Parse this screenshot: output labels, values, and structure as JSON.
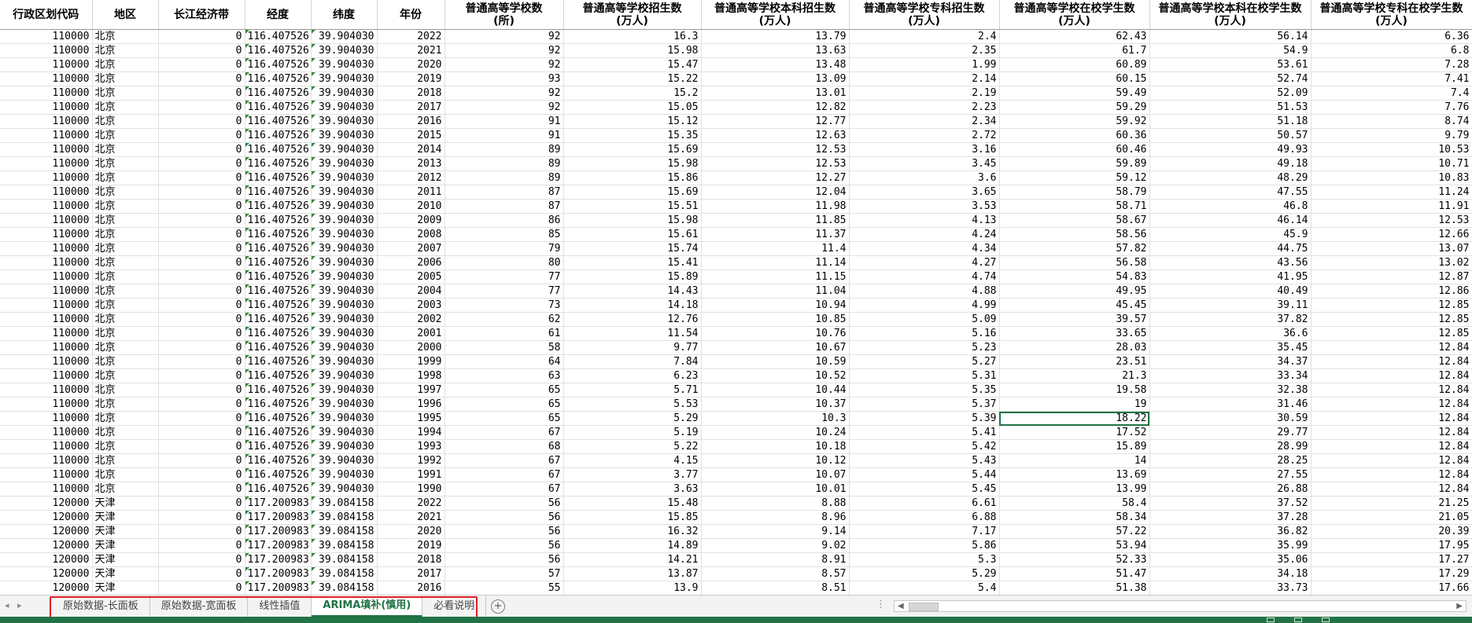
{
  "columns": [
    "行政区划代码",
    "地区",
    "长江经济带",
    "经度",
    "纬度",
    "年份",
    "普通高等学校数\n(所)",
    "普通高等学校招生数\n(万人)",
    "普通高等学校本科招生数\n(万人)",
    "普通高等学校专科招生数\n(万人)",
    "普通高等学校在校学生数\n(万人)",
    "普通高等学校本科在校学生数(万人)",
    "普通高等学校专科在校学生数(万人)"
  ],
  "rows": [
    [
      "110000",
      "北京",
      "0",
      "116.407526",
      "39.904030",
      "2022",
      "92",
      "16.3",
      "13.79",
      "2.4",
      "62.43",
      "56.14",
      "6.36"
    ],
    [
      "110000",
      "北京",
      "0",
      "116.407526",
      "39.904030",
      "2021",
      "92",
      "15.98",
      "13.63",
      "2.35",
      "61.7",
      "54.9",
      "6.8"
    ],
    [
      "110000",
      "北京",
      "0",
      "116.407526",
      "39.904030",
      "2020",
      "92",
      "15.47",
      "13.48",
      "1.99",
      "60.89",
      "53.61",
      "7.28"
    ],
    [
      "110000",
      "北京",
      "0",
      "116.407526",
      "39.904030",
      "2019",
      "93",
      "15.22",
      "13.09",
      "2.14",
      "60.15",
      "52.74",
      "7.41"
    ],
    [
      "110000",
      "北京",
      "0",
      "116.407526",
      "39.904030",
      "2018",
      "92",
      "15.2",
      "13.01",
      "2.19",
      "59.49",
      "52.09",
      "7.4"
    ],
    [
      "110000",
      "北京",
      "0",
      "116.407526",
      "39.904030",
      "2017",
      "92",
      "15.05",
      "12.82",
      "2.23",
      "59.29",
      "51.53",
      "7.76"
    ],
    [
      "110000",
      "北京",
      "0",
      "116.407526",
      "39.904030",
      "2016",
      "91",
      "15.12",
      "12.77",
      "2.34",
      "59.92",
      "51.18",
      "8.74"
    ],
    [
      "110000",
      "北京",
      "0",
      "116.407526",
      "39.904030",
      "2015",
      "91",
      "15.35",
      "12.63",
      "2.72",
      "60.36",
      "50.57",
      "9.79"
    ],
    [
      "110000",
      "北京",
      "0",
      "116.407526",
      "39.904030",
      "2014",
      "89",
      "15.69",
      "12.53",
      "3.16",
      "60.46",
      "49.93",
      "10.53"
    ],
    [
      "110000",
      "北京",
      "0",
      "116.407526",
      "39.904030",
      "2013",
      "89",
      "15.98",
      "12.53",
      "3.45",
      "59.89",
      "49.18",
      "10.71"
    ],
    [
      "110000",
      "北京",
      "0",
      "116.407526",
      "39.904030",
      "2012",
      "89",
      "15.86",
      "12.27",
      "3.6",
      "59.12",
      "48.29",
      "10.83"
    ],
    [
      "110000",
      "北京",
      "0",
      "116.407526",
      "39.904030",
      "2011",
      "87",
      "15.69",
      "12.04",
      "3.65",
      "58.79",
      "47.55",
      "11.24"
    ],
    [
      "110000",
      "北京",
      "0",
      "116.407526",
      "39.904030",
      "2010",
      "87",
      "15.51",
      "11.98",
      "3.53",
      "58.71",
      "46.8",
      "11.91"
    ],
    [
      "110000",
      "北京",
      "0",
      "116.407526",
      "39.904030",
      "2009",
      "86",
      "15.98",
      "11.85",
      "4.13",
      "58.67",
      "46.14",
      "12.53"
    ],
    [
      "110000",
      "北京",
      "0",
      "116.407526",
      "39.904030",
      "2008",
      "85",
      "15.61",
      "11.37",
      "4.24",
      "58.56",
      "45.9",
      "12.66"
    ],
    [
      "110000",
      "北京",
      "0",
      "116.407526",
      "39.904030",
      "2007",
      "79",
      "15.74",
      "11.4",
      "4.34",
      "57.82",
      "44.75",
      "13.07"
    ],
    [
      "110000",
      "北京",
      "0",
      "116.407526",
      "39.904030",
      "2006",
      "80",
      "15.41",
      "11.14",
      "4.27",
      "56.58",
      "43.56",
      "13.02"
    ],
    [
      "110000",
      "北京",
      "0",
      "116.407526",
      "39.904030",
      "2005",
      "77",
      "15.89",
      "11.15",
      "4.74",
      "54.83",
      "41.95",
      "12.87"
    ],
    [
      "110000",
      "北京",
      "0",
      "116.407526",
      "39.904030",
      "2004",
      "77",
      "14.43",
      "11.04",
      "4.88",
      "49.95",
      "40.49",
      "12.86"
    ],
    [
      "110000",
      "北京",
      "0",
      "116.407526",
      "39.904030",
      "2003",
      "73",
      "14.18",
      "10.94",
      "4.99",
      "45.45",
      "39.11",
      "12.85"
    ],
    [
      "110000",
      "北京",
      "0",
      "116.407526",
      "39.904030",
      "2002",
      "62",
      "12.76",
      "10.85",
      "5.09",
      "39.57",
      "37.82",
      "12.85"
    ],
    [
      "110000",
      "北京",
      "0",
      "116.407526",
      "39.904030",
      "2001",
      "61",
      "11.54",
      "10.76",
      "5.16",
      "33.65",
      "36.6",
      "12.85"
    ],
    [
      "110000",
      "北京",
      "0",
      "116.407526",
      "39.904030",
      "2000",
      "58",
      "9.77",
      "10.67",
      "5.23",
      "28.03",
      "35.45",
      "12.84"
    ],
    [
      "110000",
      "北京",
      "0",
      "116.407526",
      "39.904030",
      "1999",
      "64",
      "7.84",
      "10.59",
      "5.27",
      "23.51",
      "34.37",
      "12.84"
    ],
    [
      "110000",
      "北京",
      "0",
      "116.407526",
      "39.904030",
      "1998",
      "63",
      "6.23",
      "10.52",
      "5.31",
      "21.3",
      "33.34",
      "12.84"
    ],
    [
      "110000",
      "北京",
      "0",
      "116.407526",
      "39.904030",
      "1997",
      "65",
      "5.71",
      "10.44",
      "5.35",
      "19.58",
      "32.38",
      "12.84"
    ],
    [
      "110000",
      "北京",
      "0",
      "116.407526",
      "39.904030",
      "1996",
      "65",
      "5.53",
      "10.37",
      "5.37",
      "19",
      "31.46",
      "12.84"
    ],
    [
      "110000",
      "北京",
      "0",
      "116.407526",
      "39.904030",
      "1995",
      "65",
      "5.29",
      "10.3",
      "5.39",
      "18.22",
      "30.59",
      "12.84"
    ],
    [
      "110000",
      "北京",
      "0",
      "116.407526",
      "39.904030",
      "1994",
      "67",
      "5.19",
      "10.24",
      "5.41",
      "17.52",
      "29.77",
      "12.84"
    ],
    [
      "110000",
      "北京",
      "0",
      "116.407526",
      "39.904030",
      "1993",
      "68",
      "5.22",
      "10.18",
      "5.42",
      "15.89",
      "28.99",
      "12.84"
    ],
    [
      "110000",
      "北京",
      "0",
      "116.407526",
      "39.904030",
      "1992",
      "67",
      "4.15",
      "10.12",
      "5.43",
      "14",
      "28.25",
      "12.84"
    ],
    [
      "110000",
      "北京",
      "0",
      "116.407526",
      "39.904030",
      "1991",
      "67",
      "3.77",
      "10.07",
      "5.44",
      "13.69",
      "27.55",
      "12.84"
    ],
    [
      "110000",
      "北京",
      "0",
      "116.407526",
      "39.904030",
      "1990",
      "67",
      "3.63",
      "10.01",
      "5.45",
      "13.99",
      "26.88",
      "12.84"
    ],
    [
      "120000",
      "天津",
      "0",
      "117.200983",
      "39.084158",
      "2022",
      "56",
      "15.48",
      "8.88",
      "6.61",
      "58.4",
      "37.52",
      "21.25"
    ],
    [
      "120000",
      "天津",
      "0",
      "117.200983",
      "39.084158",
      "2021",
      "56",
      "15.85",
      "8.96",
      "6.88",
      "58.34",
      "37.28",
      "21.05"
    ],
    [
      "120000",
      "天津",
      "0",
      "117.200983",
      "39.084158",
      "2020",
      "56",
      "16.32",
      "9.14",
      "7.17",
      "57.22",
      "36.82",
      "20.39"
    ],
    [
      "120000",
      "天津",
      "0",
      "117.200983",
      "39.084158",
      "2019",
      "56",
      "14.89",
      "9.02",
      "5.86",
      "53.94",
      "35.99",
      "17.95"
    ],
    [
      "120000",
      "天津",
      "0",
      "117.200983",
      "39.084158",
      "2018",
      "56",
      "14.21",
      "8.91",
      "5.3",
      "52.33",
      "35.06",
      "17.27"
    ],
    [
      "120000",
      "天津",
      "0",
      "117.200983",
      "39.084158",
      "2017",
      "57",
      "13.87",
      "8.57",
      "5.29",
      "51.47",
      "34.18",
      "17.29"
    ],
    [
      "120000",
      "天津",
      "0",
      "117.200983",
      "39.084158",
      "2016",
      "55",
      "13.9",
      "8.51",
      "5.4",
      "51.38",
      "33.73",
      "17.66"
    ]
  ],
  "active_cell": {
    "row": 27,
    "col": 10,
    "value": "18.22"
  },
  "sheet_tabs": [
    {
      "label": "原始数据-长面板",
      "active": false
    },
    {
      "label": "原始数据-宽面板",
      "active": false
    },
    {
      "label": "线性插值",
      "active": false
    },
    {
      "label": "ARIMA填补(慎用)",
      "active": true
    },
    {
      "label": "必看说明",
      "active": false
    }
  ],
  "add_sheet_label": "+",
  "colors": {
    "accent": "#217346",
    "highlight_box": "#e02020",
    "flag": "#2e8b3e"
  }
}
